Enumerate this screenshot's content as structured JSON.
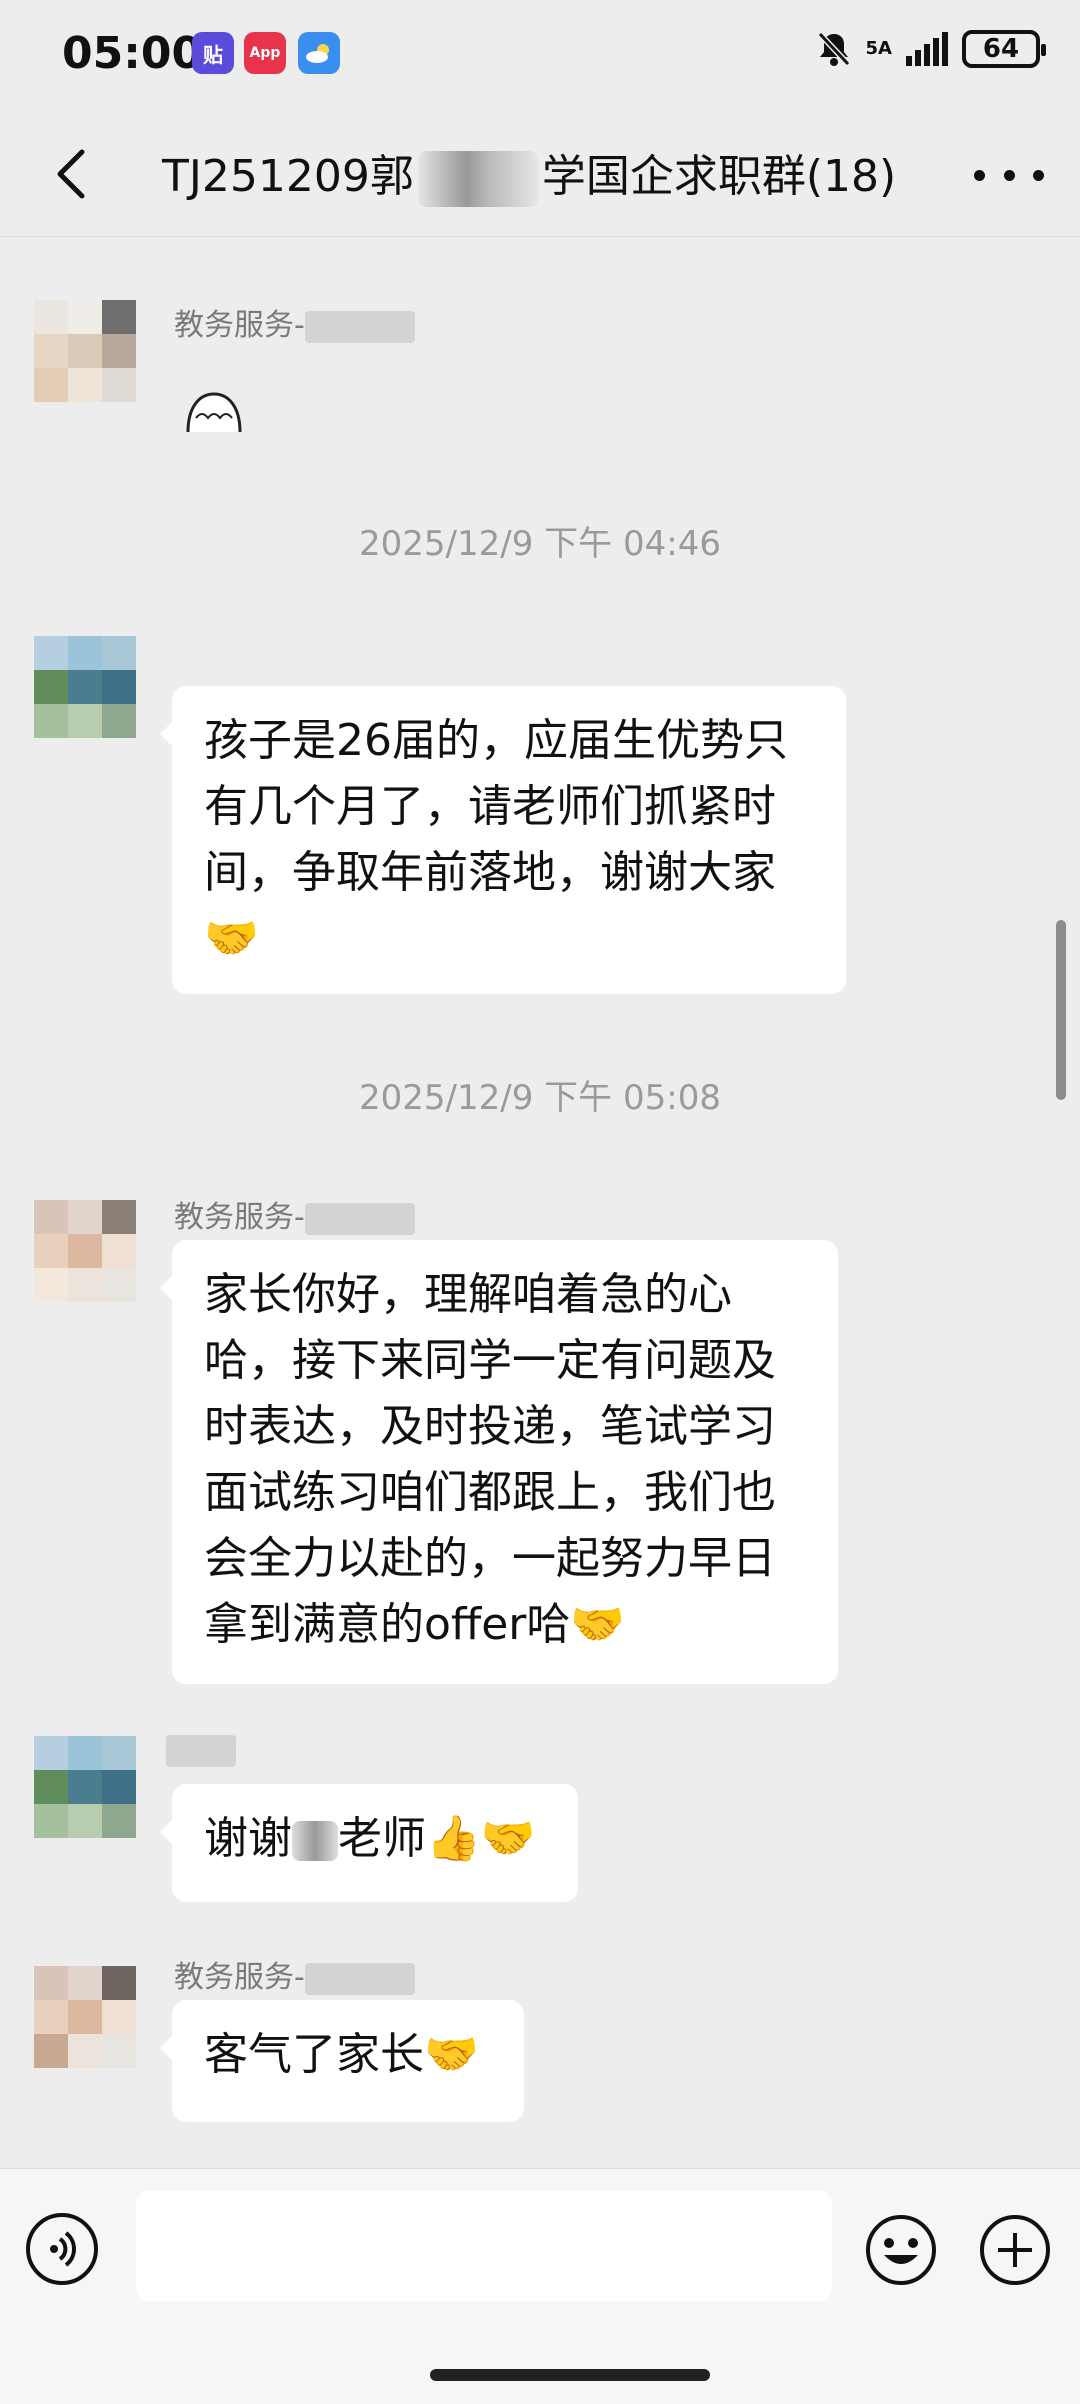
{
  "status": {
    "time": "05:00",
    "app_icons": [
      {
        "label": "贴",
        "color": "#5b4bdb"
      },
      {
        "label": "App",
        "color": "#e8334a"
      },
      {
        "label": "",
        "color": "#3a8ef0"
      }
    ],
    "network": "5A",
    "battery": "64"
  },
  "header": {
    "title_start": "TJ251209郭",
    "title_end": "学国企求职群(18)"
  },
  "messages": [
    {
      "sender": "教务服务-",
      "type": "sticker"
    },
    {
      "timestamp": "2025/12/9 下午 04:46"
    },
    {
      "sender": "",
      "text": "孩子是26届的，应届生优势只有几个月了，请老师们抓紧时间，争取年前落地，谢谢大家🤝"
    },
    {
      "timestamp": "2025/12/9 下午 05:08"
    },
    {
      "sender": "教务服务-",
      "text": "家长你好，理解咱着急的心哈，接下来同学一定有问题及时表达，及时投递，笔试学习面试练习咱们都跟上，我们也会全力以赴的，一起努力早日拿到满意的offer哈🤝"
    },
    {
      "sender": "",
      "text_before": "谢谢",
      "text_after": "老师👍🤝"
    },
    {
      "sender": "教务服务-",
      "text": "客气了家长🤝"
    }
  ],
  "input": {
    "placeholder": ""
  },
  "icons": {
    "back": "chevron-left-icon",
    "more": "more-dots-icon",
    "voice": "voice-icon",
    "emoji": "emoji-icon",
    "plus": "plus-icon"
  }
}
